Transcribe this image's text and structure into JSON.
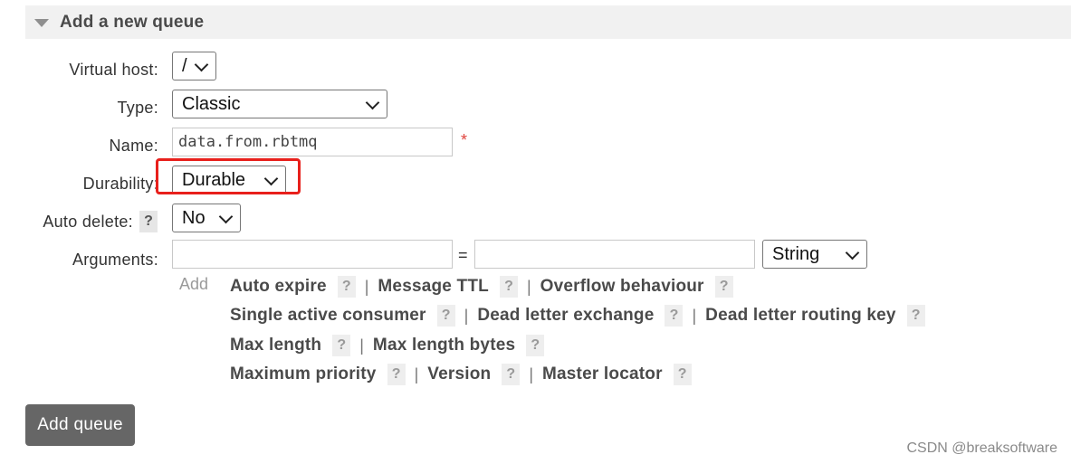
{
  "header": {
    "title": "Add a new queue"
  },
  "form": {
    "virtual_host": {
      "label": "Virtual host:",
      "value": "/"
    },
    "type": {
      "label": "Type:",
      "value": "Classic"
    },
    "name": {
      "label": "Name:",
      "value": "data.from.rbtmq",
      "required_mark": "*"
    },
    "durability": {
      "label": "Durability:",
      "value": "Durable"
    },
    "auto_delete": {
      "label": "Auto delete:",
      "help": "?",
      "value": "No"
    },
    "arguments": {
      "label": "Arguments:",
      "key": "",
      "equals": "=",
      "value": "",
      "type_value": "String",
      "add_label": "Add"
    }
  },
  "argument_links": [
    [
      {
        "label": "Auto expire",
        "help": "?"
      },
      {
        "label": "Message TTL",
        "help": "?"
      },
      {
        "label": "Overflow behaviour",
        "help": "?"
      }
    ],
    [
      {
        "label": "Single active consumer",
        "help": "?"
      },
      {
        "label": "Dead letter exchange",
        "help": "?"
      },
      {
        "label": "Dead letter routing key",
        "help": "?"
      }
    ],
    [
      {
        "label": "Max length",
        "help": "?"
      },
      {
        "label": "Max length bytes",
        "help": "?"
      }
    ],
    [
      {
        "label": "Maximum priority",
        "help": "?"
      },
      {
        "label": "Version",
        "help": "?"
      },
      {
        "label": "Master locator",
        "help": "?"
      }
    ]
  ],
  "separator": "|",
  "submit": {
    "label": "Add queue"
  },
  "watermark": "CSDN @breaksoftware",
  "colors": {
    "highlight": "#e8201c",
    "button": "#666666",
    "header_bg": "#f1f1f1"
  }
}
